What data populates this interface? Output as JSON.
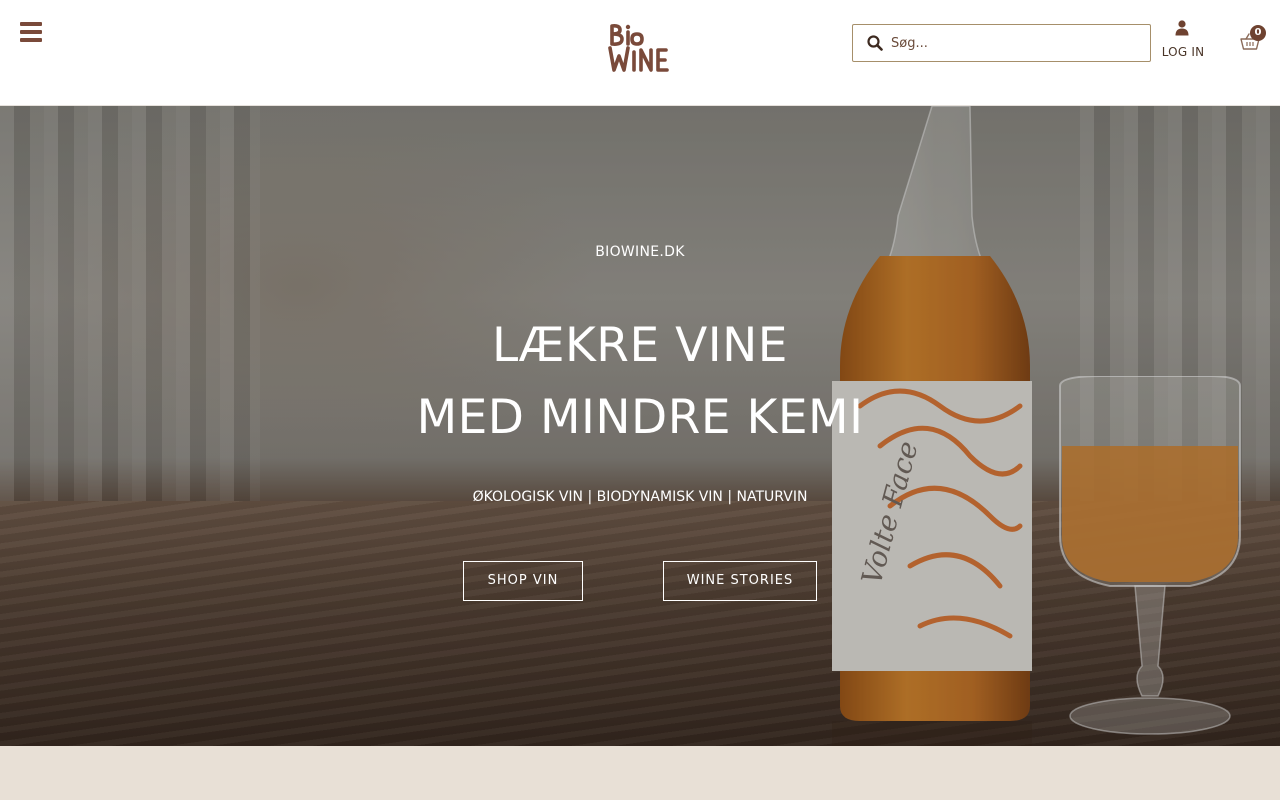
{
  "header": {
    "menu_icon": "hamburger-menu-icon",
    "logo_text": "BIO WINE",
    "search": {
      "placeholder": "Søg..."
    },
    "login_label": "LOG IN",
    "cart_count": "0"
  },
  "hero": {
    "kicker": "BIOWINE.DK",
    "title_line1": "LÆKRE VINE",
    "title_line2": "MED MINDRE KEMI",
    "subtitle": "ØKOLOGISK VIN | BIODYNAMISK VIN | NATURVIN",
    "buttons": {
      "shop": "SHOP VIN",
      "stories": "WINE STORIES"
    },
    "bottle_label_text": "Volte Face"
  },
  "colors": {
    "brand": "#7a4a3a",
    "search_border": "#a68f6a",
    "band": "#e8e0d6"
  }
}
